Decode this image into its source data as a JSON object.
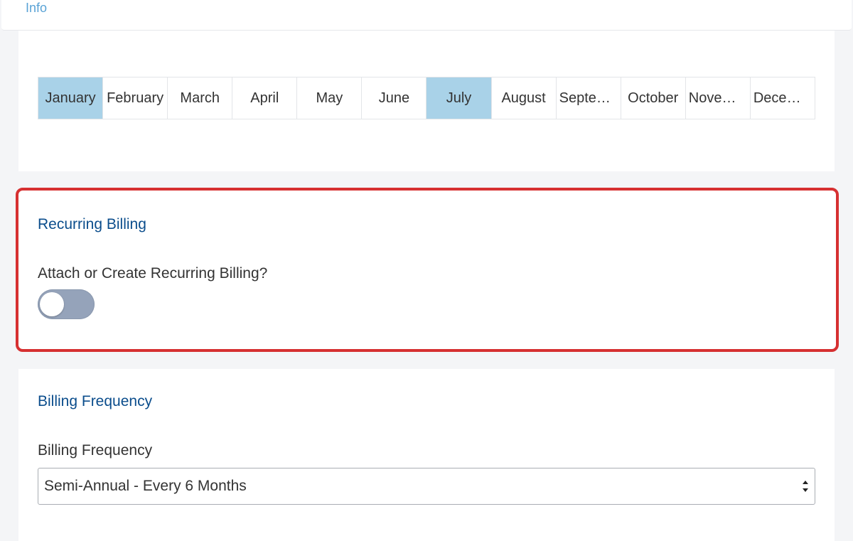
{
  "top_tab": {
    "label": "Info"
  },
  "months": [
    {
      "label": "January",
      "selected": true
    },
    {
      "label": "February",
      "selected": false
    },
    {
      "label": "March",
      "selected": false
    },
    {
      "label": "April",
      "selected": false
    },
    {
      "label": "May",
      "selected": false
    },
    {
      "label": "June",
      "selected": false
    },
    {
      "label": "July",
      "selected": true
    },
    {
      "label": "August",
      "selected": false
    },
    {
      "label": "September",
      "selected": false
    },
    {
      "label": "October",
      "selected": false
    },
    {
      "label": "November",
      "selected": false
    },
    {
      "label": "December",
      "selected": false
    }
  ],
  "recurring": {
    "title": "Recurring Billing",
    "question": "Attach or Create Recurring Billing?",
    "toggle_on": false
  },
  "billing": {
    "title": "Billing Frequency",
    "label": "Billing Frequency",
    "selected_value": "Semi-Annual - Every 6 Months"
  },
  "colors": {
    "selected_month_bg": "#a9d2e8",
    "section_title": "#0b4d8c",
    "highlight_border": "#d63031",
    "toggle_off_bg": "#95a3ba"
  }
}
